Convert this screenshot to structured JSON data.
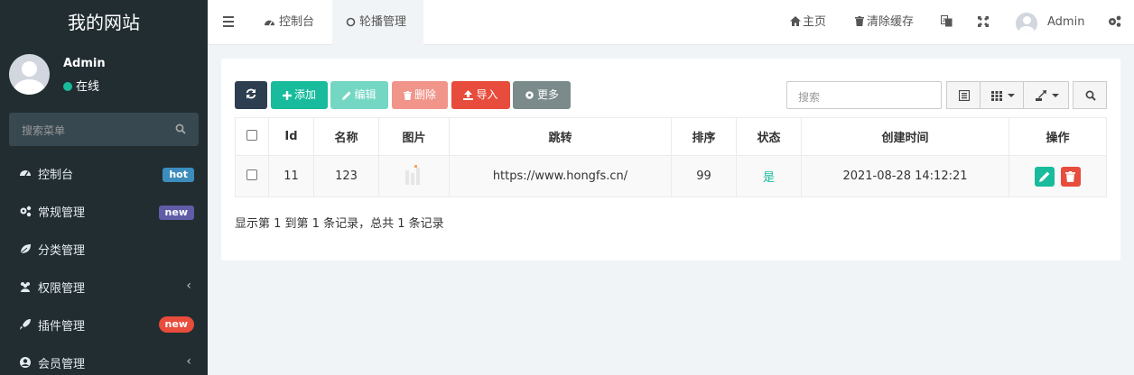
{
  "sidebar": {
    "brand": "我的网站",
    "user": {
      "name": "Admin",
      "status": "在线"
    },
    "search_placeholder": "搜索菜单",
    "items": [
      {
        "label": "控制台",
        "icon": "dashboard-icon",
        "badge": "hot"
      },
      {
        "label": "常规管理",
        "icon": "cogs-icon",
        "badge": "new"
      },
      {
        "label": "分类管理",
        "icon": "leaf-icon"
      },
      {
        "label": "权限管理",
        "icon": "group-icon",
        "chevron": "‹"
      },
      {
        "label": "插件管理",
        "icon": "rocket-icon",
        "badge": "new"
      },
      {
        "label": "会员管理",
        "icon": "user-circle-icon",
        "chevron": "‹"
      }
    ]
  },
  "topbar": {
    "tabs": [
      {
        "label": "控制台",
        "icon": "dashboard-icon"
      },
      {
        "label": "轮播管理",
        "icon": "circle-icon"
      }
    ],
    "home": "主页",
    "clear_cache": "清除缓存",
    "user": "Admin"
  },
  "toolbar": {
    "refresh": "",
    "add": "添加",
    "edit": "编辑",
    "delete": "删除",
    "import": "导入",
    "more": "更多",
    "search_placeholder": "搜索"
  },
  "colors": {
    "sidebar_bg": "#222d32",
    "primary_dark": "#2c3e50",
    "success": "#18bc9c",
    "danger": "#e74c3c",
    "info": "#3c8dbc",
    "gray": "#7b8a8b"
  },
  "table": {
    "columns": [
      "Id",
      "名称",
      "图片",
      "跳转",
      "排序",
      "状态",
      "创建时间",
      "操作"
    ],
    "rows": [
      {
        "id": "11",
        "name": "123",
        "image": "thumbnail",
        "url": "https://www.hongfs.cn/",
        "sort": "99",
        "status": "是",
        "created": "2021-08-28 14:12:21"
      }
    ]
  },
  "pagination_text": "显示第 1 到第 1 条记录，总共 1 条记录"
}
